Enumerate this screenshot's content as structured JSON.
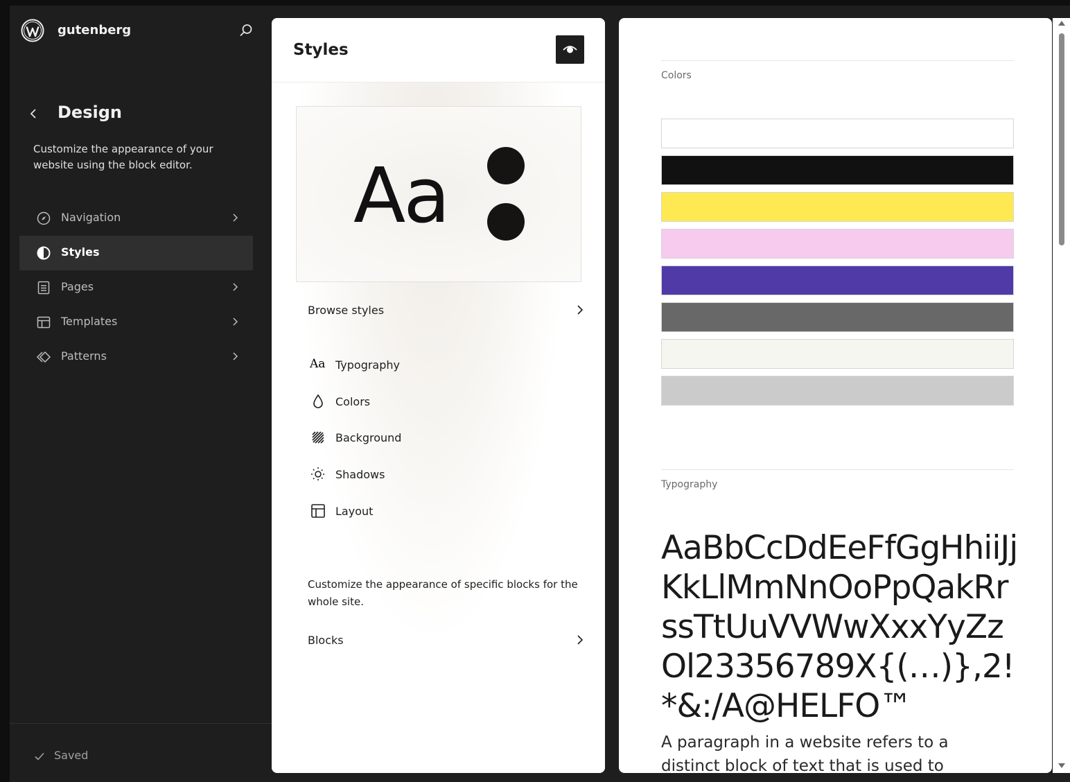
{
  "sidebar": {
    "site_name": "gutenberg",
    "title": "Design",
    "description": "Customize the appearance of your website using the block editor.",
    "nav": [
      {
        "label": "Navigation",
        "icon": "navigation-icon",
        "has_chevron": true,
        "active": false
      },
      {
        "label": "Styles",
        "icon": "styles-icon",
        "has_chevron": false,
        "active": true
      },
      {
        "label": "Pages",
        "icon": "pages-icon",
        "has_chevron": true,
        "active": false
      },
      {
        "label": "Templates",
        "icon": "templates-icon",
        "has_chevron": true,
        "active": false
      },
      {
        "label": "Patterns",
        "icon": "patterns-icon",
        "has_chevron": true,
        "active": false
      }
    ],
    "status": "Saved"
  },
  "styles_panel": {
    "title": "Styles",
    "preview_text": "Aa",
    "browse_styles": "Browse styles",
    "items": [
      {
        "label": "Typography",
        "icon": "typography-icon",
        "icon_text": "Aa"
      },
      {
        "label": "Colors",
        "icon": "colors-icon"
      },
      {
        "label": "Background",
        "icon": "background-icon"
      },
      {
        "label": "Shadows",
        "icon": "shadows-icon"
      },
      {
        "label": "Layout",
        "icon": "layout-icon"
      }
    ],
    "blocks_description": "Customize the appearance of specific blocks for the whole site.",
    "blocks_label": "Blocks"
  },
  "canvas": {
    "colors_label": "Colors",
    "swatches": [
      "#ffffff",
      "#111111",
      "#ffe953",
      "#f6cbee",
      "#503aa8",
      "#686868",
      "#f6f6f0",
      "#cbcbcb"
    ],
    "typography_label": "Typography",
    "type_sample": "AaBbCcDdEeFfGgHhiiJjKkLlMmNnOoPpQakRrssTtUuVVWwXxxYyZzOl23356789X{(…)},2!*&:/A@HELFO™",
    "paragraph_sample": "A paragraph in a website refers to a distinct block of text that is used to present and"
  }
}
